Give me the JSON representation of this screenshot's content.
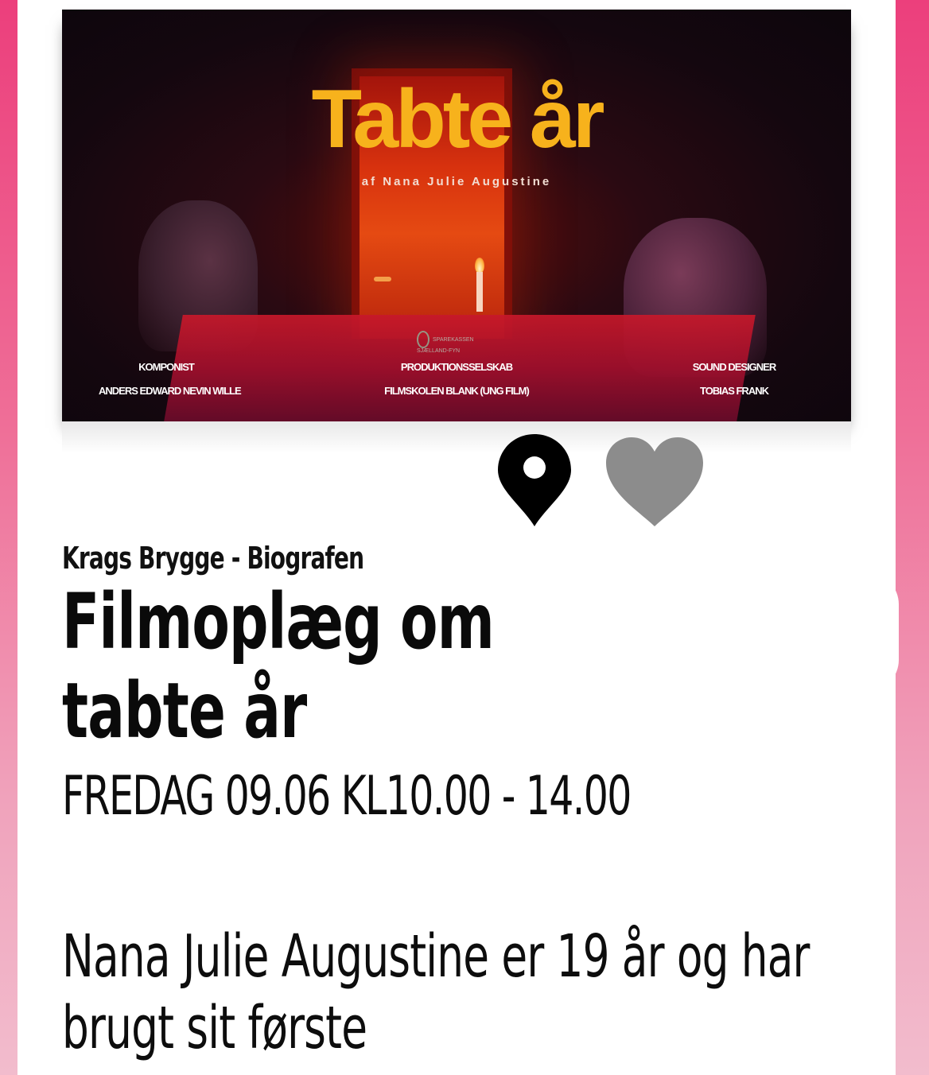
{
  "poster": {
    "title": "Tabte år",
    "subtitle": "af Nana Julie Augustine",
    "sponsor_text": "SPAREKASSEN SJÆLLAND-FYN",
    "credits": [
      {
        "role": "KOMPONIST",
        "name": "ANDERS EDWARD NEVIN WILLE"
      },
      {
        "role": "PRODUKTIONSSELSKAB",
        "name": "FILMSKOLEN BLANK (UNG FILM)"
      },
      {
        "role": "SOUND DESIGNER",
        "name": "TOBIAS FRANK"
      }
    ]
  },
  "actions": {
    "location_icon": "map-pin-icon",
    "favorite_icon": "heart-icon"
  },
  "event": {
    "venue": "Krags Brygge - Biografen",
    "title_line1": "Filmoplæg om",
    "title_line2": "tabte år",
    "date": "FREDAG 09.06 KL10.00 - 14.00",
    "description": "Nana Julie Augustine er 19 år og har brugt sit første"
  },
  "colors": {
    "background_top": "#ec3f7c",
    "background_bottom": "#f2bccd",
    "card": "#ffffff",
    "poster_title": "#f7b21c",
    "heart": "#8c8c8c",
    "pin": "#000000"
  }
}
